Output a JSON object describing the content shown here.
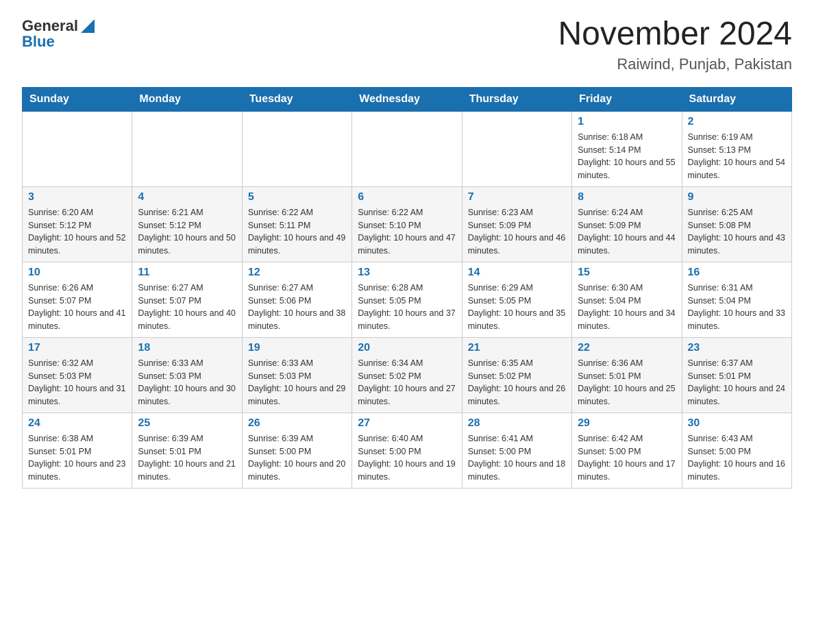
{
  "header": {
    "logo_general": "General",
    "logo_blue": "Blue",
    "month_title": "November 2024",
    "location": "Raiwind, Punjab, Pakistan"
  },
  "days_of_week": [
    "Sunday",
    "Monday",
    "Tuesday",
    "Wednesday",
    "Thursday",
    "Friday",
    "Saturday"
  ],
  "weeks": [
    [
      {
        "day": "",
        "sunrise": "",
        "sunset": "",
        "daylight": ""
      },
      {
        "day": "",
        "sunrise": "",
        "sunset": "",
        "daylight": ""
      },
      {
        "day": "",
        "sunrise": "",
        "sunset": "",
        "daylight": ""
      },
      {
        "day": "",
        "sunrise": "",
        "sunset": "",
        "daylight": ""
      },
      {
        "day": "",
        "sunrise": "",
        "sunset": "",
        "daylight": ""
      },
      {
        "day": "1",
        "sunrise": "Sunrise: 6:18 AM",
        "sunset": "Sunset: 5:14 PM",
        "daylight": "Daylight: 10 hours and 55 minutes."
      },
      {
        "day": "2",
        "sunrise": "Sunrise: 6:19 AM",
        "sunset": "Sunset: 5:13 PM",
        "daylight": "Daylight: 10 hours and 54 minutes."
      }
    ],
    [
      {
        "day": "3",
        "sunrise": "Sunrise: 6:20 AM",
        "sunset": "Sunset: 5:12 PM",
        "daylight": "Daylight: 10 hours and 52 minutes."
      },
      {
        "day": "4",
        "sunrise": "Sunrise: 6:21 AM",
        "sunset": "Sunset: 5:12 PM",
        "daylight": "Daylight: 10 hours and 50 minutes."
      },
      {
        "day": "5",
        "sunrise": "Sunrise: 6:22 AM",
        "sunset": "Sunset: 5:11 PM",
        "daylight": "Daylight: 10 hours and 49 minutes."
      },
      {
        "day": "6",
        "sunrise": "Sunrise: 6:22 AM",
        "sunset": "Sunset: 5:10 PM",
        "daylight": "Daylight: 10 hours and 47 minutes."
      },
      {
        "day": "7",
        "sunrise": "Sunrise: 6:23 AM",
        "sunset": "Sunset: 5:09 PM",
        "daylight": "Daylight: 10 hours and 46 minutes."
      },
      {
        "day": "8",
        "sunrise": "Sunrise: 6:24 AM",
        "sunset": "Sunset: 5:09 PM",
        "daylight": "Daylight: 10 hours and 44 minutes."
      },
      {
        "day": "9",
        "sunrise": "Sunrise: 6:25 AM",
        "sunset": "Sunset: 5:08 PM",
        "daylight": "Daylight: 10 hours and 43 minutes."
      }
    ],
    [
      {
        "day": "10",
        "sunrise": "Sunrise: 6:26 AM",
        "sunset": "Sunset: 5:07 PM",
        "daylight": "Daylight: 10 hours and 41 minutes."
      },
      {
        "day": "11",
        "sunrise": "Sunrise: 6:27 AM",
        "sunset": "Sunset: 5:07 PM",
        "daylight": "Daylight: 10 hours and 40 minutes."
      },
      {
        "day": "12",
        "sunrise": "Sunrise: 6:27 AM",
        "sunset": "Sunset: 5:06 PM",
        "daylight": "Daylight: 10 hours and 38 minutes."
      },
      {
        "day": "13",
        "sunrise": "Sunrise: 6:28 AM",
        "sunset": "Sunset: 5:05 PM",
        "daylight": "Daylight: 10 hours and 37 minutes."
      },
      {
        "day": "14",
        "sunrise": "Sunrise: 6:29 AM",
        "sunset": "Sunset: 5:05 PM",
        "daylight": "Daylight: 10 hours and 35 minutes."
      },
      {
        "day": "15",
        "sunrise": "Sunrise: 6:30 AM",
        "sunset": "Sunset: 5:04 PM",
        "daylight": "Daylight: 10 hours and 34 minutes."
      },
      {
        "day": "16",
        "sunrise": "Sunrise: 6:31 AM",
        "sunset": "Sunset: 5:04 PM",
        "daylight": "Daylight: 10 hours and 33 minutes."
      }
    ],
    [
      {
        "day": "17",
        "sunrise": "Sunrise: 6:32 AM",
        "sunset": "Sunset: 5:03 PM",
        "daylight": "Daylight: 10 hours and 31 minutes."
      },
      {
        "day": "18",
        "sunrise": "Sunrise: 6:33 AM",
        "sunset": "Sunset: 5:03 PM",
        "daylight": "Daylight: 10 hours and 30 minutes."
      },
      {
        "day": "19",
        "sunrise": "Sunrise: 6:33 AM",
        "sunset": "Sunset: 5:03 PM",
        "daylight": "Daylight: 10 hours and 29 minutes."
      },
      {
        "day": "20",
        "sunrise": "Sunrise: 6:34 AM",
        "sunset": "Sunset: 5:02 PM",
        "daylight": "Daylight: 10 hours and 27 minutes."
      },
      {
        "day": "21",
        "sunrise": "Sunrise: 6:35 AM",
        "sunset": "Sunset: 5:02 PM",
        "daylight": "Daylight: 10 hours and 26 minutes."
      },
      {
        "day": "22",
        "sunrise": "Sunrise: 6:36 AM",
        "sunset": "Sunset: 5:01 PM",
        "daylight": "Daylight: 10 hours and 25 minutes."
      },
      {
        "day": "23",
        "sunrise": "Sunrise: 6:37 AM",
        "sunset": "Sunset: 5:01 PM",
        "daylight": "Daylight: 10 hours and 24 minutes."
      }
    ],
    [
      {
        "day": "24",
        "sunrise": "Sunrise: 6:38 AM",
        "sunset": "Sunset: 5:01 PM",
        "daylight": "Daylight: 10 hours and 23 minutes."
      },
      {
        "day": "25",
        "sunrise": "Sunrise: 6:39 AM",
        "sunset": "Sunset: 5:01 PM",
        "daylight": "Daylight: 10 hours and 21 minutes."
      },
      {
        "day": "26",
        "sunrise": "Sunrise: 6:39 AM",
        "sunset": "Sunset: 5:00 PM",
        "daylight": "Daylight: 10 hours and 20 minutes."
      },
      {
        "day": "27",
        "sunrise": "Sunrise: 6:40 AM",
        "sunset": "Sunset: 5:00 PM",
        "daylight": "Daylight: 10 hours and 19 minutes."
      },
      {
        "day": "28",
        "sunrise": "Sunrise: 6:41 AM",
        "sunset": "Sunset: 5:00 PM",
        "daylight": "Daylight: 10 hours and 18 minutes."
      },
      {
        "day": "29",
        "sunrise": "Sunrise: 6:42 AM",
        "sunset": "Sunset: 5:00 PM",
        "daylight": "Daylight: 10 hours and 17 minutes."
      },
      {
        "day": "30",
        "sunrise": "Sunrise: 6:43 AM",
        "sunset": "Sunset: 5:00 PM",
        "daylight": "Daylight: 10 hours and 16 minutes."
      }
    ]
  ]
}
